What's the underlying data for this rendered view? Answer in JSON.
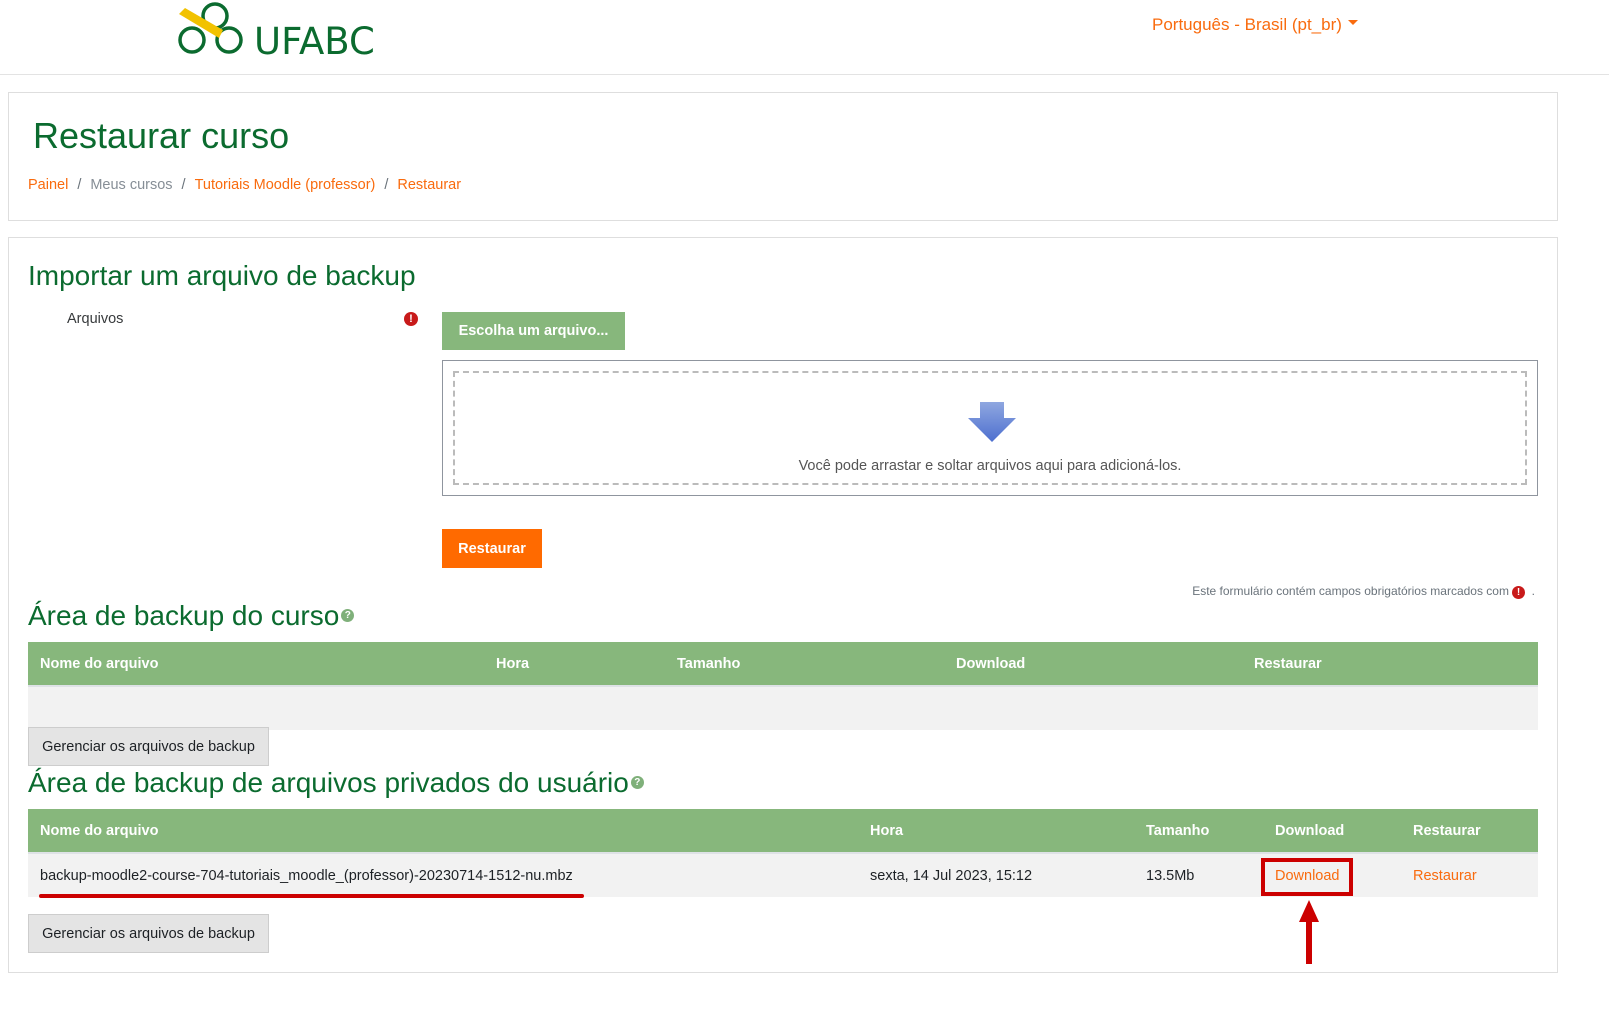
{
  "navbar": {
    "logo_text": "UFABC",
    "language": "Português - Brasil (pt_br)"
  },
  "header": {
    "title": "Restaurar curso",
    "breadcrumb": [
      {
        "label": "Painel",
        "link": true
      },
      {
        "label": "Meus cursos",
        "link": false
      },
      {
        "label": "Tutoriais Moodle (professor)",
        "link": true
      },
      {
        "label": "Restaurar",
        "link": true
      }
    ],
    "separator": "/"
  },
  "import": {
    "heading": "Importar um arquivo de backup",
    "files_label": "Arquivos",
    "required_icon": "!",
    "choose_button": "Escolha um arquivo...",
    "dropzone_icon": "down-arrow-icon",
    "dropzone_text": "Você pode arrastar e soltar arquivos aqui para adicioná-los.",
    "restore_button": "Restaurar",
    "required_note": "Este formulário contém campos obrigatórios marcados com",
    "required_note_suffix": "."
  },
  "course_backup": {
    "heading": "Área de backup do curso",
    "help_icon": "?",
    "columns": [
      "Nome do arquivo",
      "Hora",
      "Tamanho",
      "Download",
      "Restaurar"
    ],
    "rows": [],
    "manage_button": "Gerenciar os arquivos de backup"
  },
  "user_backup": {
    "heading": "Área de backup de arquivos privados do usuário",
    "help_icon": "?",
    "columns": [
      "Nome do arquivo",
      "Hora",
      "Tamanho",
      "Download",
      "Restaurar"
    ],
    "rows": [
      {
        "filename": "backup-moodle2-course-704-tutoriais_moodle_(professor)-20230714-1512-nu.mbz",
        "time": "sexta, 14 Jul 2023, 15:12",
        "size": "13.5Mb",
        "download": "Download",
        "restore": "Restaurar"
      }
    ],
    "manage_button": "Gerenciar os arquivos de backup"
  },
  "annotations": {
    "highlight_color": "#cc0000"
  },
  "colors": {
    "brand_green": "#0b6b2f",
    "accent_orange": "#f96b0e",
    "table_header": "#87b77c",
    "restore_button": "#ff6a00",
    "required_red": "#c81a1a"
  }
}
